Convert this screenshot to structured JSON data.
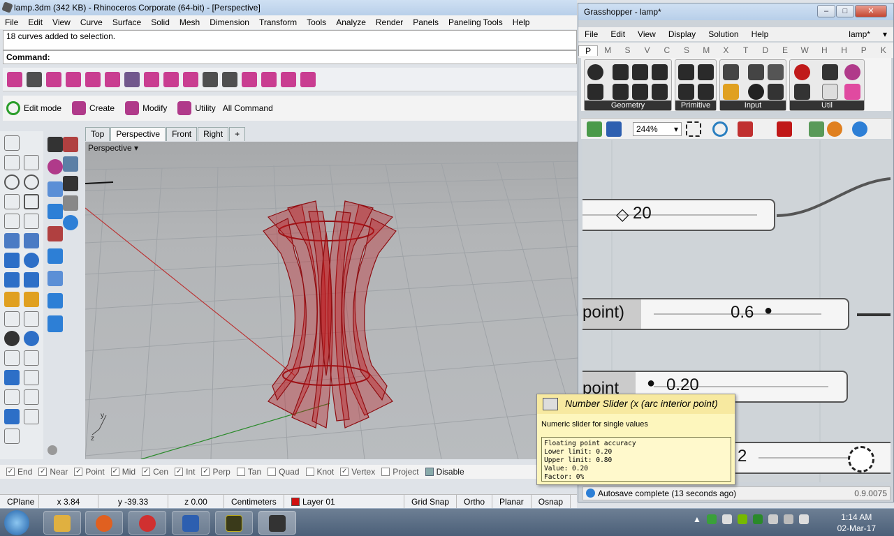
{
  "rhino": {
    "title": "lamp.3dm (342 KB) - Rhinoceros Corporate (64-bit) - [Perspective]",
    "menu": [
      "File",
      "Edit",
      "View",
      "Curve",
      "Surface",
      "Solid",
      "Mesh",
      "Dimension",
      "Transform",
      "Tools",
      "Analyze",
      "Render",
      "Panels",
      "Paneling Tools",
      "Help"
    ],
    "history": "18 curves added to selection.",
    "command_label": "Command:",
    "toolbar2": [
      "Edit mode",
      "Create",
      "Modify",
      "Utility",
      "All Command"
    ],
    "viewport_tabs": [
      "Top",
      "Perspective",
      "Front",
      "Right",
      "+"
    ],
    "viewport_label": "Perspective",
    "snaps": [
      {
        "label": "End",
        "checked": true
      },
      {
        "label": "Near",
        "checked": true
      },
      {
        "label": "Point",
        "checked": true
      },
      {
        "label": "Mid",
        "checked": true
      },
      {
        "label": "Cen",
        "checked": true
      },
      {
        "label": "Int",
        "checked": true
      },
      {
        "label": "Perp",
        "checked": true
      },
      {
        "label": "Tan",
        "checked": false
      },
      {
        "label": "Quad",
        "checked": false
      },
      {
        "label": "Knot",
        "checked": false
      },
      {
        "label": "Vertex",
        "checked": true
      },
      {
        "label": "Project",
        "checked": false
      },
      {
        "label": "Disable",
        "checked": false
      }
    ],
    "status": {
      "cplane": "CPlane",
      "x": "x 3.84",
      "y": "y -39.33",
      "z": "z 0.00",
      "units": "Centimeters",
      "layer": "Layer 01",
      "grid_snap": "Grid Snap",
      "ortho": "Ortho",
      "planar": "Planar",
      "osnap": "Osnap"
    },
    "colors": {
      "object": "#c0181c",
      "layer": "#d01010"
    }
  },
  "grasshopper": {
    "title": "Grasshopper - lamp*",
    "menu": [
      "File",
      "Edit",
      "View",
      "Display",
      "Solution",
      "Help"
    ],
    "doc": "lamp*",
    "tabs": [
      "P",
      "M",
      "S",
      "V",
      "C",
      "S",
      "M",
      "X",
      "T",
      "D",
      "E",
      "W",
      "H",
      "H",
      "P",
      "K"
    ],
    "groups": [
      "Geometry",
      "Primitive",
      "Input",
      "Util"
    ],
    "zoom": "244%",
    "canvas": {
      "slider1_value": "20",
      "slider2_label": "point)",
      "slider2_value": "0.6",
      "slider3_label": "point",
      "slider3_value": "0.20",
      "slider4_value": "2"
    },
    "tooltip": {
      "title": "Number Slider (x (arc interior point)",
      "desc": "Numeric slider for single values",
      "details": "Floating point accuracy\nLower limit: 0.20\nUpper limit: 0.80\nValue: 0.20\nFactor: 0%"
    },
    "status": "Autosave complete (13 seconds ago)",
    "version": "0.9.0075"
  },
  "taskbar": {
    "time": "1:14 AM",
    "date": "02-Mar-17"
  }
}
